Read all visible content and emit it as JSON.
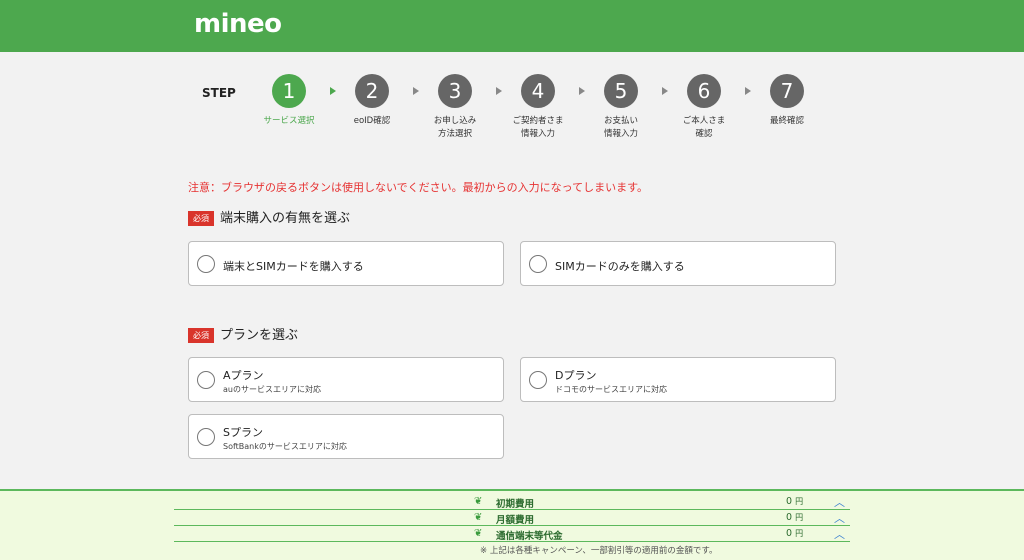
{
  "header": {
    "logo_text": "mineo"
  },
  "steps": {
    "label": "STEP",
    "items": [
      {
        "num": "1",
        "label": "サービス選択"
      },
      {
        "num": "2",
        "label": "eoID確認"
      },
      {
        "num": "3",
        "label": "お申し込み\n方法選択"
      },
      {
        "num": "4",
        "label": "ご契約者さま\n情報入力"
      },
      {
        "num": "5",
        "label": "お支払い\n情報入力"
      },
      {
        "num": "6",
        "label": "ご本人さま\n確認"
      },
      {
        "num": "7",
        "label": "最終確認"
      }
    ]
  },
  "notice": "注意：ブラウザの戻るボタンは使用しないでください。最初からの入力になってしまいます。",
  "device_section": {
    "required": "必須",
    "title": "端末購入の有無を選ぶ",
    "options": [
      {
        "label": "端末とSIMカードを購入する"
      },
      {
        "label": "SIMカードのみを購入する"
      }
    ]
  },
  "plan_section": {
    "required": "必須",
    "title": "プランを選ぶ",
    "options": [
      {
        "label": "Aプラン",
        "sub": "auのサービスエリアに対応"
      },
      {
        "label": "Dプラン",
        "sub": "ドコモのサービスエリアに対応"
      },
      {
        "label": "Sプラン",
        "sub": "SoftBankのサービスエリアに対応"
      }
    ]
  },
  "footer": {
    "rows": [
      {
        "label": "初期費用",
        "value": "0",
        "unit": "円"
      },
      {
        "label": "月額費用",
        "value": "0",
        "unit": "円"
      },
      {
        "label": "通信端末等代金",
        "value": "0",
        "unit": "円"
      }
    ],
    "note": "※ 上記は各種キャンペーン、一部割引等の適用前の金額です。"
  },
  "colors": {
    "brand": "#4da84e",
    "required": "#d9342b",
    "notice": "#e63232"
  }
}
